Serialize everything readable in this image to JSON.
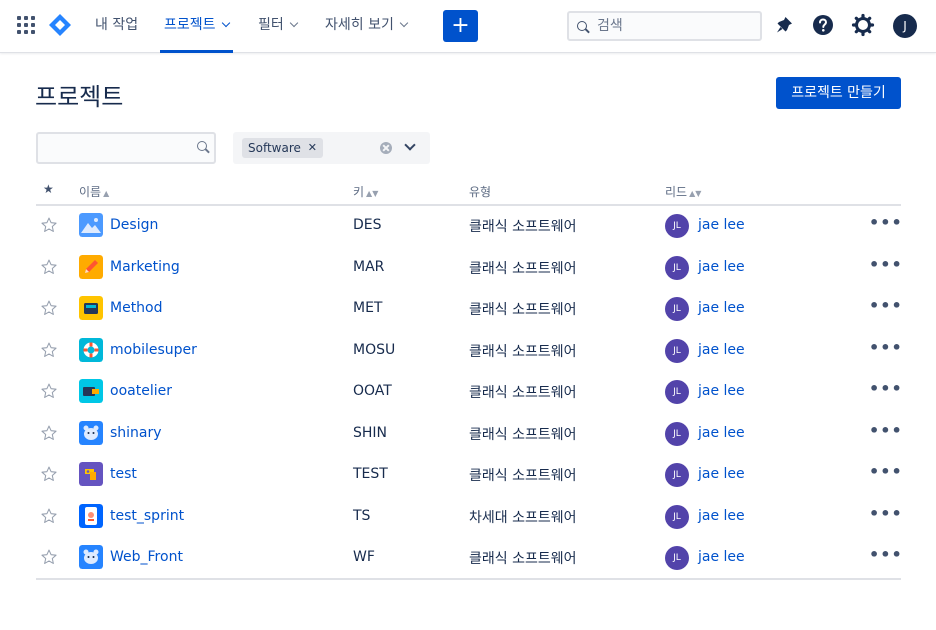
{
  "topnav": {
    "items": [
      {
        "label": "내 작업",
        "active": false,
        "dropdown": false
      },
      {
        "label": "프로젝트",
        "active": true,
        "dropdown": true
      },
      {
        "label": "필터",
        "active": false,
        "dropdown": true
      },
      {
        "label": "자세히 보기",
        "active": false,
        "dropdown": true
      }
    ],
    "create_label": "+",
    "search_placeholder": "검색",
    "user_initial": "J",
    "icons": [
      "app-switcher-icon",
      "jira-logo-icon",
      "notification-icon",
      "help-icon",
      "settings-icon"
    ]
  },
  "page": {
    "title": "프로젝트",
    "create_button": "프로젝트 만들기"
  },
  "filters": {
    "search_value": "",
    "type_chip": "Software",
    "chip_remove": "✕"
  },
  "table": {
    "headers": {
      "star": "★",
      "name": "이름",
      "key": "키",
      "type": "유형",
      "lead": "리드"
    },
    "sort_name": "▲",
    "sort_key": "▲▼",
    "sort_lead": "▲▼",
    "rows": [
      {
        "name": "Design",
        "key": "DES",
        "type": "클래식 소프트웨어",
        "lead_initials": "JL",
        "lead": "jae lee",
        "more": "•••",
        "icon": "mountain-avatar",
        "color": "#4c9aff"
      },
      {
        "name": "Marketing",
        "key": "MAR",
        "type": "클래식 소프트웨어",
        "lead_initials": "JL",
        "lead": "jae lee",
        "more": "•••",
        "icon": "pencil-avatar",
        "color": "#ffab00"
      },
      {
        "name": "Method",
        "key": "MET",
        "type": "클래식 소프트웨어",
        "lead_initials": "JL",
        "lead": "jae lee",
        "more": "•••",
        "icon": "box-avatar",
        "color": "#ffc400"
      },
      {
        "name": "mobilesuper",
        "key": "MOSU",
        "type": "클래식 소프트웨어",
        "lead_initials": "JL",
        "lead": "jae lee",
        "more": "•••",
        "icon": "lifebuoy-avatar",
        "color": "#00b8d9"
      },
      {
        "name": "ooatelier",
        "key": "OOAT",
        "type": "클래식 소프트웨어",
        "lead_initials": "JL",
        "lead": "jae lee",
        "more": "•••",
        "icon": "film-avatar",
        "color": "#00c7e6"
      },
      {
        "name": "shinary",
        "key": "SHIN",
        "type": "클래식 소프트웨어",
        "lead_initials": "JL",
        "lead": "jae lee",
        "more": "•••",
        "icon": "bear-avatar",
        "color": "#2684ff"
      },
      {
        "name": "test",
        "key": "TEST",
        "type": "클래식 소프트웨어",
        "lead_initials": "JL",
        "lead": "jae lee",
        "more": "•••",
        "icon": "puzzle-avatar",
        "color": "#6554c0"
      },
      {
        "name": "test_sprint",
        "key": "TS",
        "type": "차세대 소프트웨어",
        "lead_initials": "JL",
        "lead": "jae lee",
        "more": "•••",
        "icon": "phone-avatar",
        "color": "#0065ff"
      },
      {
        "name": "Web_Front",
        "key": "WF",
        "type": "클래식 소프트웨어",
        "lead_initials": "JL",
        "lead": "jae lee",
        "more": "•••",
        "icon": "bear-avatar",
        "color": "#2684ff"
      }
    ]
  }
}
